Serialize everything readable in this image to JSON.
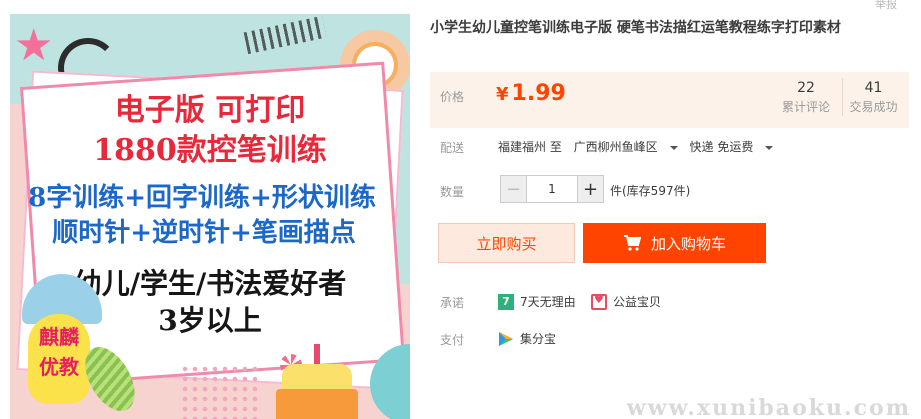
{
  "product": {
    "title": "小学生幼儿童控笔训练电子版 硬笔书法描红运笔教程练字打印素材",
    "top_right_text": "举报"
  },
  "image": {
    "line1": "电子版 可打印",
    "line2": "1880款控笔训练",
    "line3": "8字训练+回字训练+形状训练",
    "line4": "顺时针+逆时针+笔画描点",
    "line5": "幼儿/学生/书法爱好者",
    "line6": "3岁以上",
    "badge_top": "麒麟",
    "badge_bottom": "优教"
  },
  "price": {
    "label": "价格",
    "currency": "¥",
    "value": "1.99",
    "reviews_count": "22",
    "reviews_label": "累计评论",
    "sales_count": "41",
    "sales_label": "交易成功"
  },
  "shipping": {
    "label": "配送",
    "from": "福建福州 至",
    "to": "广西柳州鱼峰区",
    "method": "快递 免运费"
  },
  "quantity": {
    "label": "数量",
    "value": "1",
    "minus": "−",
    "plus": "+",
    "stock": "件(库存597件)"
  },
  "actions": {
    "buy_now": "立即购买",
    "add_to_cart": "加入购物车"
  },
  "promise": {
    "label": "承诺",
    "icon7_text": "7",
    "returns": "7天无理由",
    "charity": "公益宝贝"
  },
  "payment": {
    "label": "支付",
    "method": "集分宝"
  },
  "watermark": "www.xunibaoku.com",
  "colors": {
    "accent": "#ff4400",
    "price_bg": "#fdf2ea",
    "buy_now_bg": "#fee9df"
  }
}
